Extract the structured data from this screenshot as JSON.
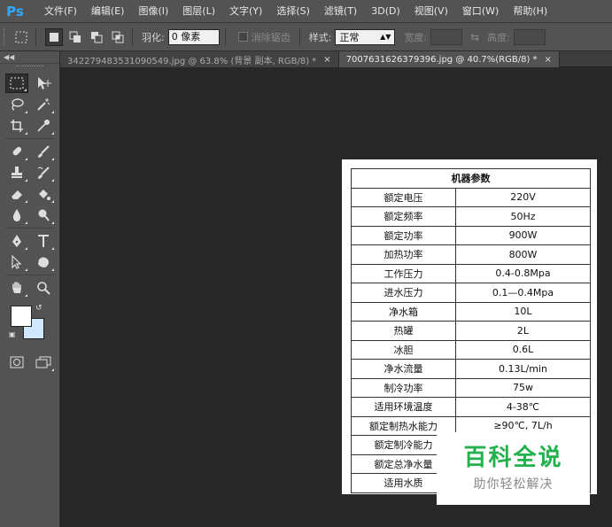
{
  "app": {
    "logo": "Ps"
  },
  "menu": [
    "文件(F)",
    "编辑(E)",
    "图像(I)",
    "图层(L)",
    "文字(Y)",
    "选择(S)",
    "滤镜(T)",
    "3D(D)",
    "视图(V)",
    "窗口(W)",
    "帮助(H)"
  ],
  "options": {
    "feather_label": "羽化:",
    "feather_value": "0 像素",
    "antialias_label": "消除锯齿",
    "style_label": "样式:",
    "style_value": "正常",
    "width_label": "宽度:",
    "height_label": "高度:"
  },
  "tabs": [
    {
      "label": "342279483531090549.jpg @ 63.8% (背景 副本, RGB/8) *",
      "close": "×",
      "active": false
    },
    {
      "label": "7007631626379396.jpg @ 40.7%(RGB/8) *",
      "close": "×",
      "active": true
    }
  ],
  "colors": {
    "foreground": "#ffffff",
    "background": "#cfe7ff",
    "watermark_green": "#22b14c"
  },
  "spec_table": {
    "title": "机器参数",
    "rows": [
      [
        "额定电压",
        "220V"
      ],
      [
        "额定频率",
        "50Hz"
      ],
      [
        "额定功率",
        "900W"
      ],
      [
        "加热功率",
        "800W"
      ],
      [
        "工作压力",
        "0.4-0.8Mpa"
      ],
      [
        "进水压力",
        "0.1—0.4Mpa"
      ],
      [
        "净水箱",
        "10L"
      ],
      [
        "热罐",
        "2L"
      ],
      [
        "冰胆",
        "0.6L"
      ],
      [
        "净水流量",
        "0.13L/min"
      ],
      [
        "制冷功率",
        "75w"
      ],
      [
        "适用环境温度",
        "4-38℃"
      ],
      [
        "额定制热水能力",
        "≥90℃, 7L/h"
      ],
      [
        "额定制冷能力",
        ""
      ],
      [
        "额定总净水量",
        ""
      ],
      [
        "适用水质",
        ""
      ]
    ]
  },
  "watermark": {
    "main": "百科全说",
    "sub": "助你轻松解决"
  }
}
